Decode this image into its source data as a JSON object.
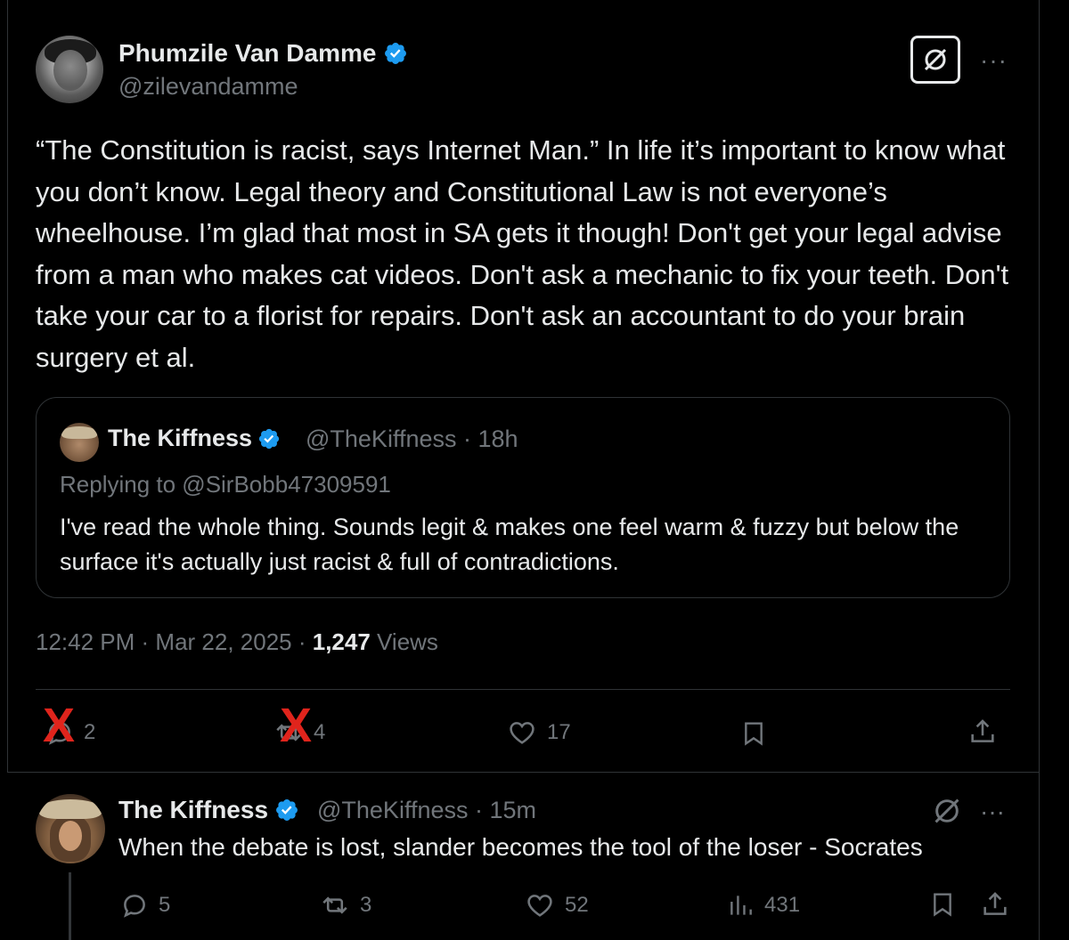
{
  "main_tweet": {
    "author_name": "Phumzile Van Damme",
    "author_handle": "@zilevandamme",
    "more_label": "···",
    "text": "“The Constitution is racist, says Internet Man.” In life it’s important to know what you don’t know. Legal theory and Constitutional Law is not everyone’s wheelhouse. I’m glad that most in SA gets it though! Don't get your legal advise from a man who makes cat videos. Don't ask a mechanic to fix your teeth. Don't take your car to a florist for repairs. Don't ask an accountant to do your brain surgery et al.",
    "time": "12:42 PM",
    "date": "Mar 22, 2025",
    "views_count": "1,247",
    "views_label": "Views",
    "replies": "2",
    "reposts": "4",
    "likes": "17"
  },
  "quoted_tweet": {
    "author_name": "The Kiffness",
    "author_handle": "@TheKiffness",
    "age": "18h",
    "replying_to": "Replying to @SirBobb47309591",
    "text": "I've read the whole thing. Sounds legit & makes one feel warm & fuzzy but below the surface it's actually just racist & full of contradictions."
  },
  "reply_tweet": {
    "author_name": "The Kiffness",
    "author_handle": "@TheKiffness",
    "age": "15m",
    "text": "When the debate is lost, slander becomes the tool of the loser - Socrates",
    "replies": "5",
    "reposts": "3",
    "likes": "52",
    "views": "431",
    "more_label": "···"
  },
  "overlay": {
    "strike_mark": "X"
  },
  "colors": {
    "background": "#000000",
    "text": "#e7e9ea",
    "muted": "#71767b",
    "verified": "#1d9bf0",
    "strike": "#e0241c"
  }
}
